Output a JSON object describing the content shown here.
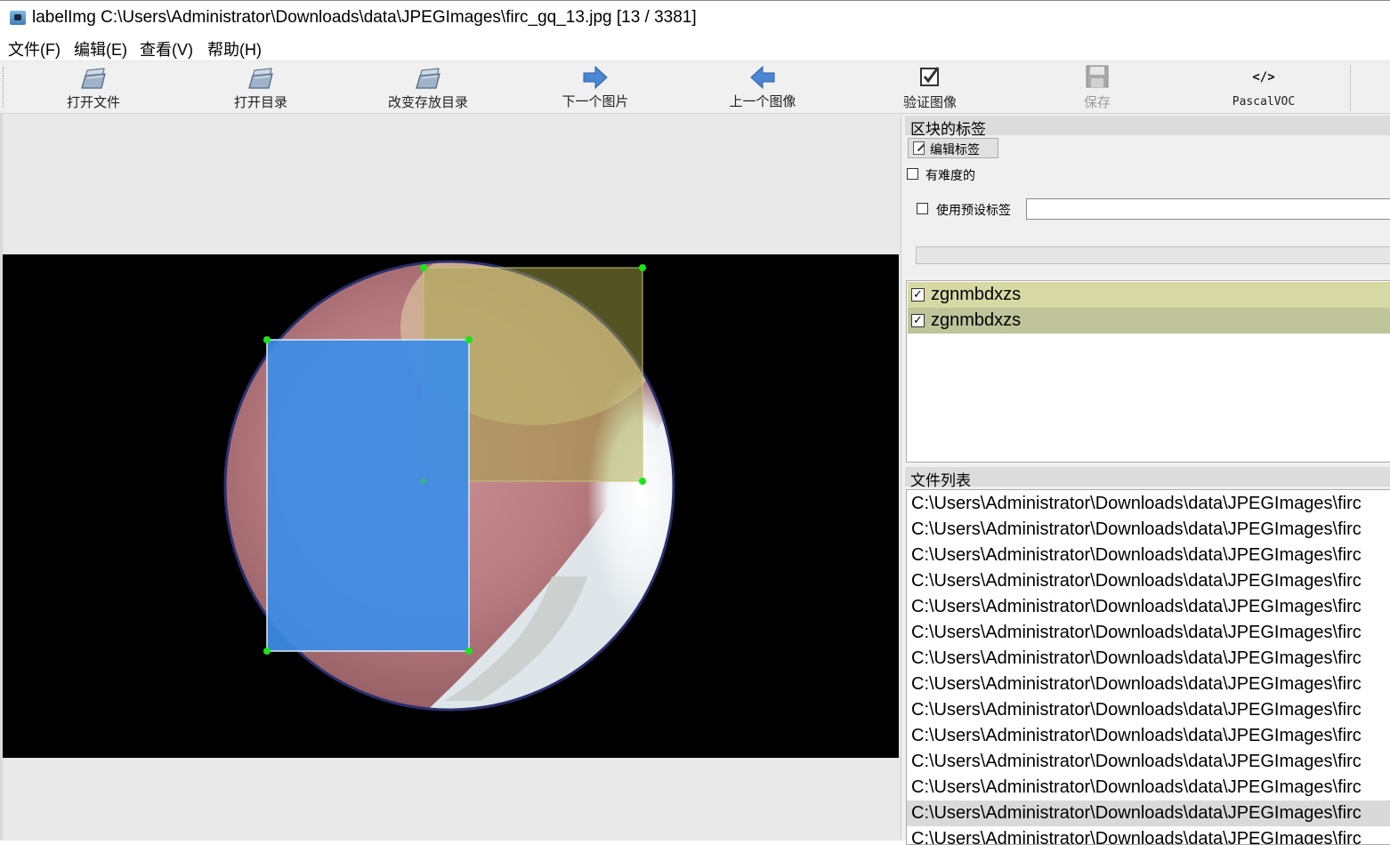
{
  "window": {
    "title": "labelImg C:\\Users\\Administrator\\Downloads\\data\\JPEGImages\\firc_gq_13.jpg [13 / 3381]"
  },
  "menu": [
    "文件(F)",
    "编辑(E)",
    "查看(V)",
    "帮助(H)"
  ],
  "toolbar": {
    "open_file": "打开文件",
    "open_dir": "打开目录",
    "change_save_dir": "改变存放目录",
    "next_image": "下一个图片",
    "prev_image": "上一个图像",
    "verify_image": "验证图像",
    "save": "保存",
    "format": "PascalVOC"
  },
  "box_labels": {
    "title": "区块的标签",
    "edit_label": "编辑标签",
    "difficult": "有难度的",
    "use_default": "使用预设标签",
    "default_value": "",
    "items": [
      {
        "label": "zgnmbdxzs",
        "checked": true,
        "color": "#d6d9a4"
      },
      {
        "label": "zgnmbdxzs",
        "checked": true,
        "color": "#bfc49a"
      }
    ]
  },
  "file_list": {
    "title": "文件列表",
    "items": [
      "C:\\Users\\Administrator\\Downloads\\data\\JPEGImages\\firc",
      "C:\\Users\\Administrator\\Downloads\\data\\JPEGImages\\firc",
      "C:\\Users\\Administrator\\Downloads\\data\\JPEGImages\\firc",
      "C:\\Users\\Administrator\\Downloads\\data\\JPEGImages\\firc",
      "C:\\Users\\Administrator\\Downloads\\data\\JPEGImages\\firc",
      "C:\\Users\\Administrator\\Downloads\\data\\JPEGImages\\firc",
      "C:\\Users\\Administrator\\Downloads\\data\\JPEGImages\\firc",
      "C:\\Users\\Administrator\\Downloads\\data\\JPEGImages\\firc",
      "C:\\Users\\Administrator\\Downloads\\data\\JPEGImages\\firc",
      "C:\\Users\\Administrator\\Downloads\\data\\JPEGImages\\firc",
      "C:\\Users\\Administrator\\Downloads\\data\\JPEGImages\\firc",
      "C:\\Users\\Administrator\\Downloads\\data\\JPEGImages\\firc",
      "C:\\Users\\Administrator\\Downloads\\data\\JPEGImages\\firc",
      "C:\\Users\\Administrator\\Downloads\\data\\JPEGImages\\firc"
    ],
    "selected_index": 12
  },
  "colors": {
    "box_blue": "#3d8de6",
    "box_olive": "#a5a545",
    "handle": "#19e619"
  }
}
